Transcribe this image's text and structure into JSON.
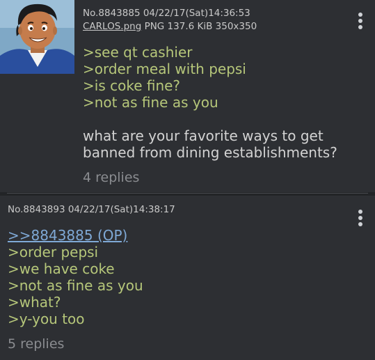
{
  "posts": [
    {
      "number": "No.8843885",
      "datetime": "04/22/17(Sat)14:36:53",
      "file_name": "CARLOS.png",
      "file_info": "PNG 137.6 KiB 350x350",
      "lines": [
        ">see qt cashier",
        ">order meal with pepsi",
        ">is coke fine?",
        ">not as fine as you"
      ],
      "comment": "what are your favorite ways to get banned from dining establishments?",
      "replies": "4 replies"
    },
    {
      "number": "No.8843893",
      "datetime": "04/22/17(Sat)14:38:17",
      "quote_link": ">>8843885 (OP)",
      "lines": [
        ">order pepsi",
        ">we have coke",
        ">not as fine as you",
        ">what?",
        ">y-you too"
      ],
      "replies": "5 replies"
    }
  ],
  "colors": {
    "background": "#222427",
    "post_background": "#2d2f33",
    "greentext": "#b6c77a",
    "quotelink": "#7fa9d6",
    "meta": "#c9c9c9",
    "replies": "#8a8c90"
  },
  "icons": {
    "menu": "overflow-menu-icon"
  }
}
